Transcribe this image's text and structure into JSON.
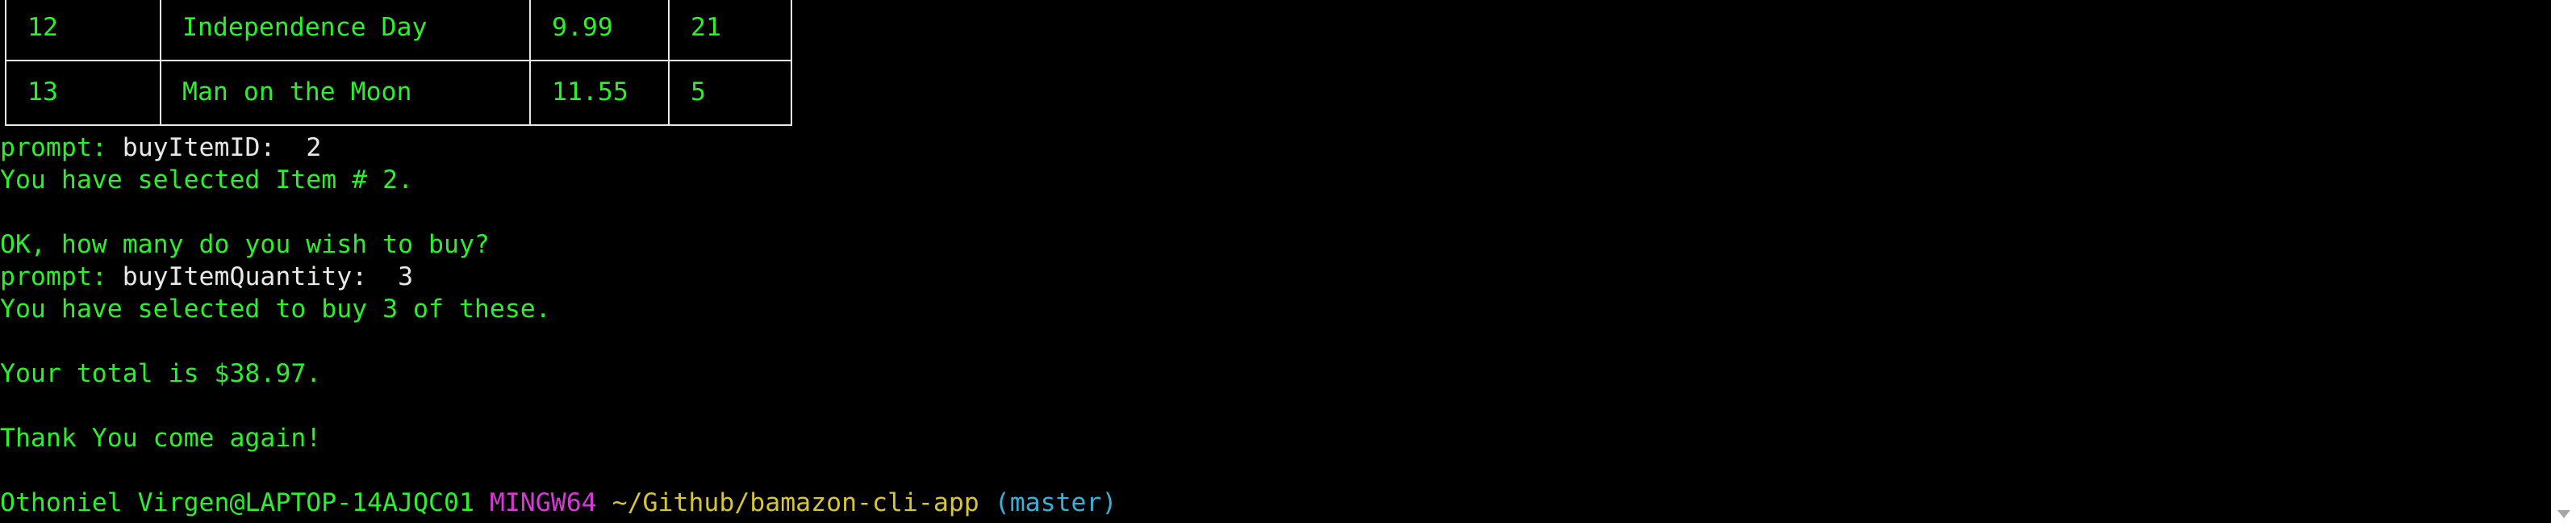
{
  "table": {
    "rows": [
      {
        "id": "12",
        "name": "Independence Day",
        "price": "9.99",
        "qty": "21"
      },
      {
        "id": "13",
        "name": "Man on the Moon",
        "price": "11.55",
        "qty": "5"
      }
    ]
  },
  "console": {
    "prompt_label": "prompt:",
    "buy_id_field": "buyItemID:",
    "buy_id_value": "2",
    "selected_item": "You have selected Item # 2.",
    "ask_quantity": "OK, how many do you wish to buy?",
    "buy_qty_field": "buyItemQuantity:",
    "buy_qty_value": "3",
    "selected_qty": "You have selected to buy 3 of these.",
    "total": "Your total is $38.97.",
    "goodbye": "Thank You come again!"
  },
  "shell_prompt": {
    "user_host": "Othoniel Virgen@LAPTOP-14AJQC01",
    "system": "MINGW64",
    "path": "~/Github/bamazon-cli-app",
    "branch": "(master)"
  },
  "colors": {
    "text_green": "#2cf02c",
    "background": "#000000",
    "system_magenta": "#d63ad6",
    "path_yellow": "#d8c43a",
    "branch_cyan": "#3ab0d8"
  }
}
